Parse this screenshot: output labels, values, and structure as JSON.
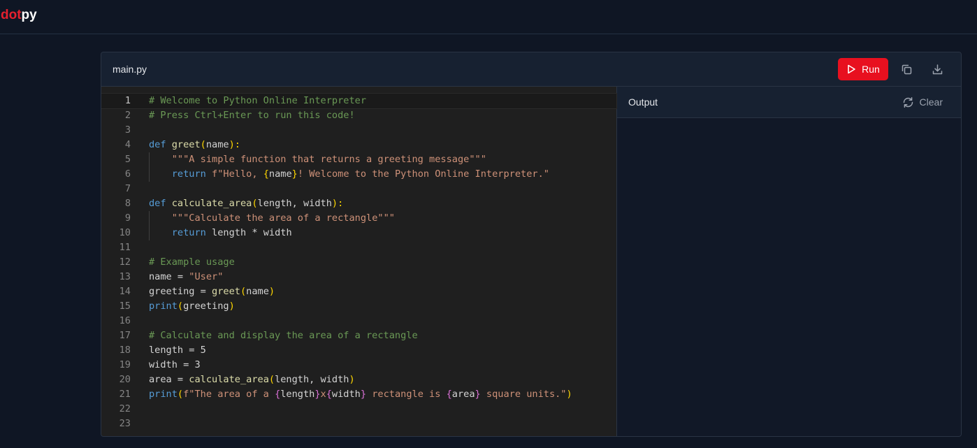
{
  "app": {
    "logo_part1": "dot",
    "logo_part2": "py"
  },
  "editor": {
    "filename": "main.py",
    "run_label": "Run",
    "copy_icon": "copy-icon",
    "download_icon": "download-icon",
    "active_line": 1,
    "lines": [
      [
        [
          "c-com",
          "# Welcome to Python Online Interpreter"
        ]
      ],
      [
        [
          "c-com",
          "# Press Ctrl+Enter to run this code!"
        ]
      ],
      [],
      [
        [
          "c-kw",
          "def "
        ],
        [
          "c-fn",
          "greet"
        ],
        [
          "c-p1",
          "("
        ],
        [
          "c-var",
          "name"
        ],
        [
          "c-p1",
          "):"
        ]
      ],
      [
        [
          "c-var",
          "    "
        ],
        [
          "c-str",
          "\"\"\"A simple function that returns a greeting message\"\"\""
        ]
      ],
      [
        [
          "c-var",
          "    "
        ],
        [
          "c-kw",
          "return "
        ],
        [
          "c-str",
          "f\"Hello, "
        ],
        [
          "c-p1",
          "{"
        ],
        [
          "c-var",
          "name"
        ],
        [
          "c-p1",
          "}"
        ],
        [
          "c-str",
          "! Welcome to the Python Online Interpreter.\""
        ]
      ],
      [],
      [
        [
          "c-kw",
          "def "
        ],
        [
          "c-fn",
          "calculate_area"
        ],
        [
          "c-p1",
          "("
        ],
        [
          "c-var",
          "length, width"
        ],
        [
          "c-p1",
          "):"
        ]
      ],
      [
        [
          "c-var",
          "    "
        ],
        [
          "c-str",
          "\"\"\"Calculate the area of a rectangle\"\"\""
        ]
      ],
      [
        [
          "c-var",
          "    "
        ],
        [
          "c-kw",
          "return "
        ],
        [
          "c-var",
          "length * width"
        ]
      ],
      [],
      [
        [
          "c-com",
          "# Example usage"
        ]
      ],
      [
        [
          "c-var",
          "name = "
        ],
        [
          "c-str",
          "\"User\""
        ]
      ],
      [
        [
          "c-var",
          "greeting = "
        ],
        [
          "c-fn",
          "greet"
        ],
        [
          "c-p1",
          "("
        ],
        [
          "c-var",
          "name"
        ],
        [
          "c-p1",
          ")"
        ]
      ],
      [
        [
          "c-kw",
          "print"
        ],
        [
          "c-p1",
          "("
        ],
        [
          "c-var",
          "greeting"
        ],
        [
          "c-p1",
          ")"
        ]
      ],
      [],
      [
        [
          "c-com",
          "# Calculate and display the area of a rectangle"
        ]
      ],
      [
        [
          "c-var",
          "length = 5"
        ]
      ],
      [
        [
          "c-var",
          "width = 3"
        ]
      ],
      [
        [
          "c-var",
          "area = "
        ],
        [
          "c-fn",
          "calculate_area"
        ],
        [
          "c-p1",
          "("
        ],
        [
          "c-var",
          "length, width"
        ],
        [
          "c-p1",
          ")"
        ]
      ],
      [
        [
          "c-kw",
          "print"
        ],
        [
          "c-p1",
          "("
        ],
        [
          "c-str",
          "f\"The area of a "
        ],
        [
          "c-p2",
          "{"
        ],
        [
          "c-var",
          "length"
        ],
        [
          "c-p2",
          "}"
        ],
        [
          "c-str",
          "x"
        ],
        [
          "c-p2",
          "{"
        ],
        [
          "c-var",
          "width"
        ],
        [
          "c-p2",
          "}"
        ],
        [
          "c-str",
          " rectangle is "
        ],
        [
          "c-p2",
          "{"
        ],
        [
          "c-var",
          "area"
        ],
        [
          "c-p2",
          "}"
        ],
        [
          "c-str",
          " square units.\""
        ],
        [
          "c-p1",
          ")"
        ]
      ],
      [],
      []
    ]
  },
  "output": {
    "title": "Output",
    "clear_label": "Clear",
    "clear_icon": "refresh-icon",
    "content": ""
  }
}
